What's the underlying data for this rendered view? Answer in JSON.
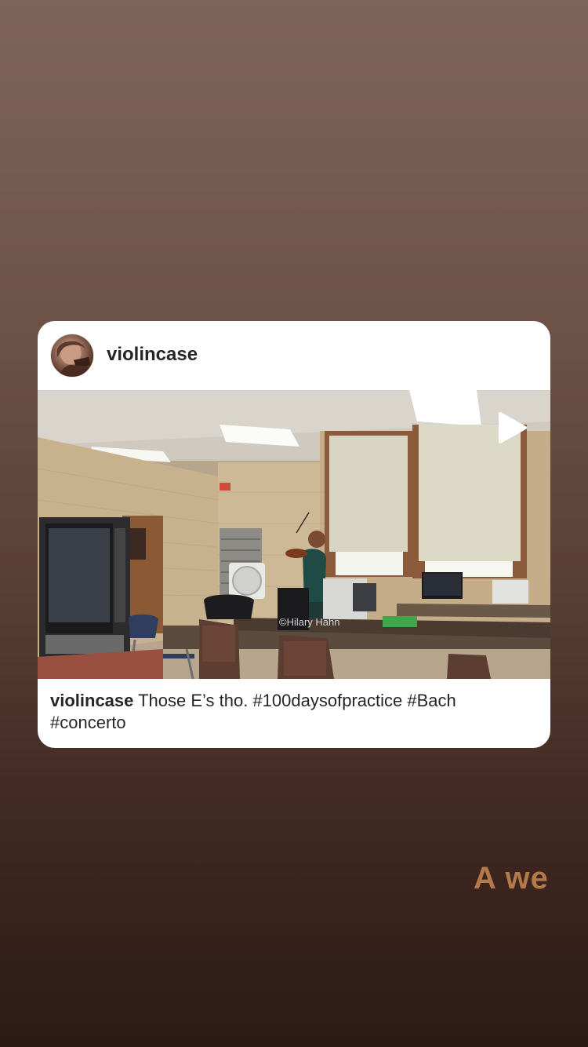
{
  "post": {
    "username": "violincase",
    "caption_user": "violincase",
    "caption_text": "Those E’s tho. #100daysofpractice #Bach #concerto",
    "watermark": "©Hilary Hahn",
    "media_type": "video",
    "icons": {
      "play": "play-icon",
      "avatar": "avatar"
    }
  },
  "story": {
    "text_sticker": "A we"
  },
  "colors": {
    "card_bg": "#ffffff",
    "text_primary": "#262626",
    "sticker_text": "#b27a4a",
    "background_top": "#7f6459",
    "background_bottom": "#2c1a15"
  }
}
